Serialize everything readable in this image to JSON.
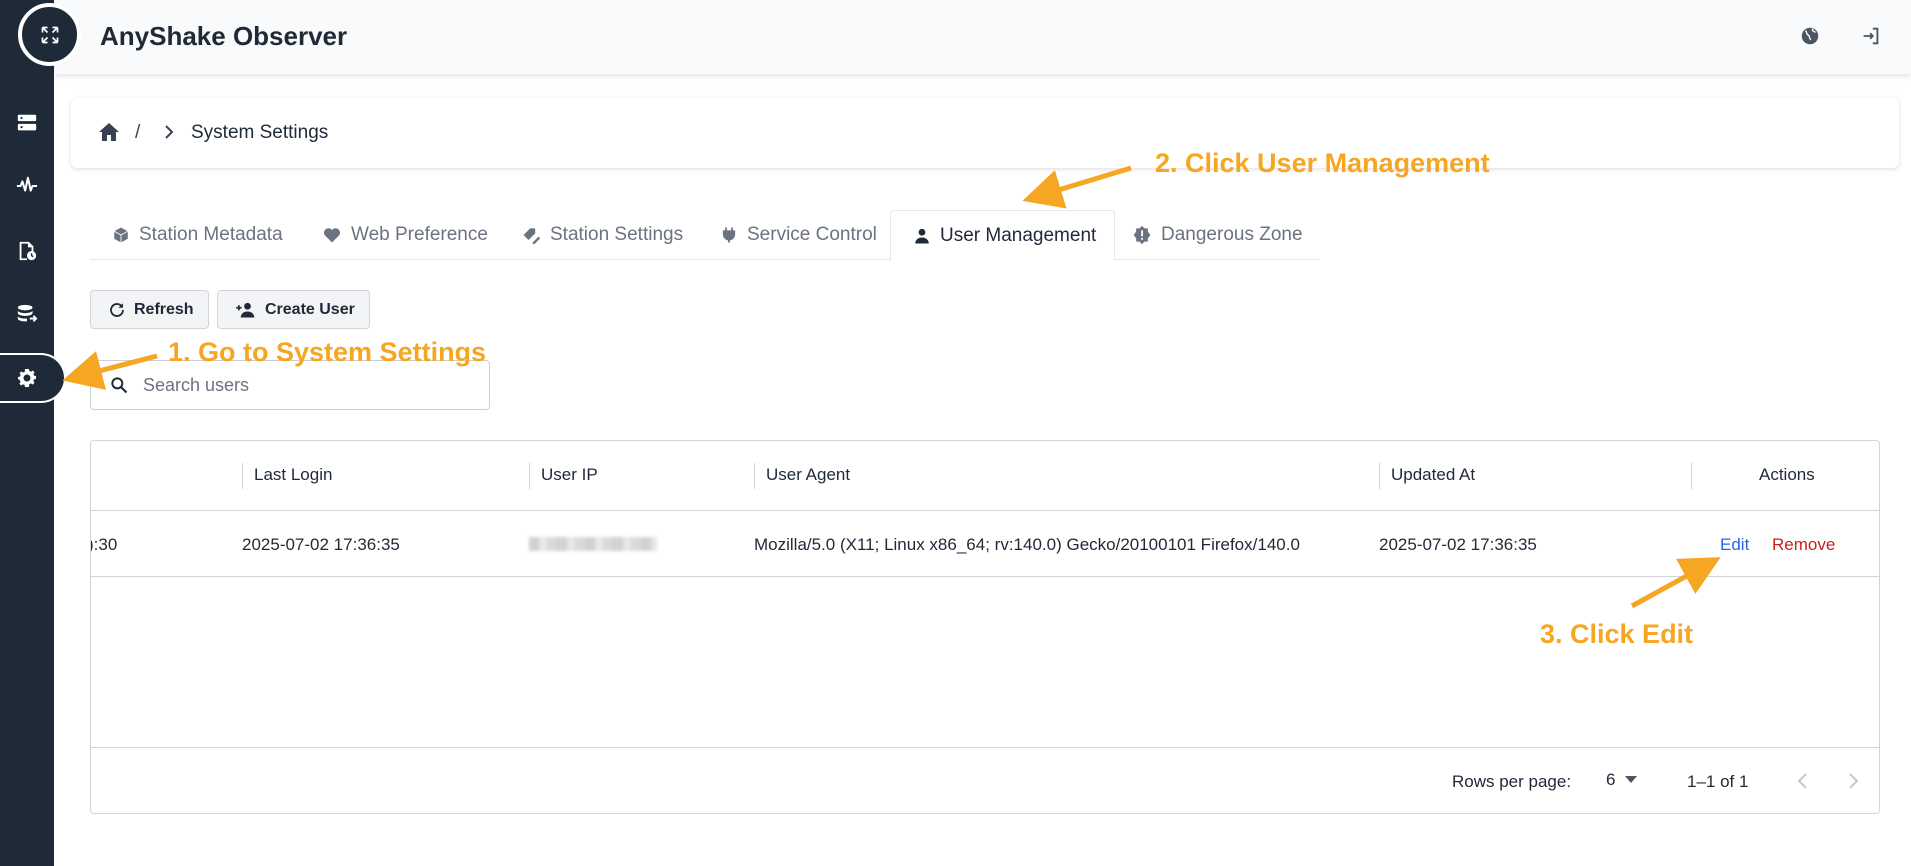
{
  "app": {
    "title": "AnyShake Observer"
  },
  "sidebar": {
    "logo_icon": "expand-icon",
    "items": [
      {
        "icon": "server-icon"
      },
      {
        "icon": "waveform-icon"
      },
      {
        "icon": "file-history-icon"
      },
      {
        "icon": "database-export-icon"
      },
      {
        "icon": "gear-icon",
        "active": true
      }
    ]
  },
  "topbar": {
    "language_icon": "globe-icon",
    "logout_icon": "logout-icon"
  },
  "breadcrumb": {
    "separator": "/",
    "current": "System Settings"
  },
  "tabs": [
    {
      "label": "Station Metadata",
      "icon": "cube-icon"
    },
    {
      "label": "Web Preference",
      "icon": "heart-icon"
    },
    {
      "label": "Station Settings",
      "icon": "settings-edit-icon"
    },
    {
      "label": "Service Control",
      "icon": "plug-icon"
    },
    {
      "label": "User Management",
      "icon": "user-icon",
      "active": true
    },
    {
      "label": "Dangerous Zone",
      "icon": "alert-icon"
    }
  ],
  "toolbar": {
    "refresh_label": "Refresh",
    "create_label": "Create User"
  },
  "search": {
    "placeholder": "Search users"
  },
  "table": {
    "headers": {
      "last_login": "Last Login",
      "user_ip": "User IP",
      "user_agent": "User Agent",
      "updated_at": "Updated At",
      "actions": "Actions"
    },
    "rows": [
      {
        "clipped_prefix": "):30",
        "last_login": "2025-07-02 17:36:35",
        "user_agent": "Mozilla/5.0 (X11; Linux x86_64; rv:140.0) Gecko/20100101 Firefox/140.0",
        "updated_at": "2025-07-02 17:36:35",
        "edit_label": "Edit",
        "remove_label": "Remove"
      }
    ],
    "footer": {
      "rows_per_page_label": "Rows per page:",
      "rows_per_page_value": "6",
      "range": "1–1 of 1"
    }
  },
  "annotations": {
    "step1": "1. Go to System Settings",
    "step2": "2. Click User Management",
    "step3": "3. Click Edit",
    "color": "#f5a623"
  }
}
